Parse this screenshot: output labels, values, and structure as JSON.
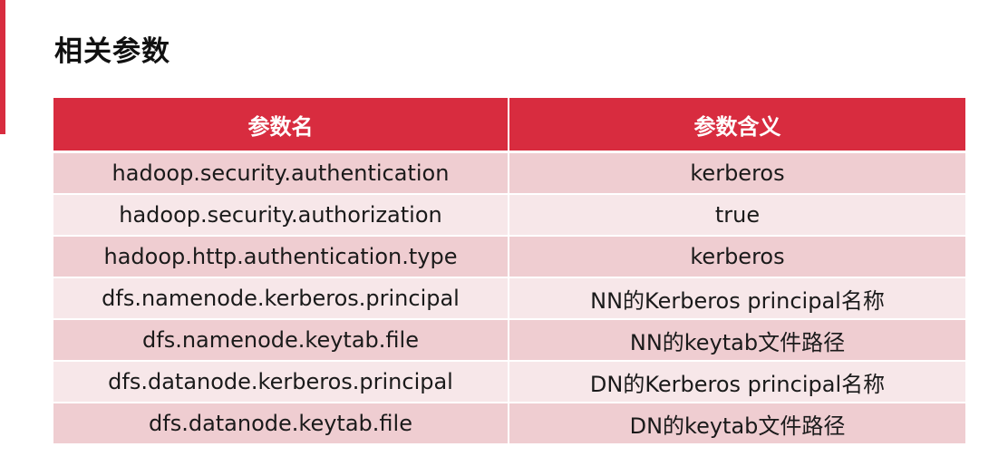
{
  "title": "相关参数",
  "colors": {
    "accent": "#d82c3f",
    "row_odd": "#efcdd1",
    "row_even": "#f7e7e9"
  },
  "table": {
    "headers": [
      "参数名",
      "参数含义"
    ],
    "rows": [
      {
        "name": "hadoop.security.authentication",
        "meaning": "kerberos"
      },
      {
        "name": "hadoop.security.authorization",
        "meaning": "true"
      },
      {
        "name": "hadoop.http.authentication.type",
        "meaning": "kerberos"
      },
      {
        "name": "dfs.namenode.kerberos.principal",
        "meaning": "NN的Kerberos principal名称"
      },
      {
        "name": "dfs.namenode.keytab.file",
        "meaning": "NN的keytab文件路径"
      },
      {
        "name": "dfs.datanode.kerberos.principal",
        "meaning": "DN的Kerberos principal名称"
      },
      {
        "name": "dfs.datanode.keytab.file",
        "meaning": "DN的keytab文件路径"
      }
    ]
  }
}
